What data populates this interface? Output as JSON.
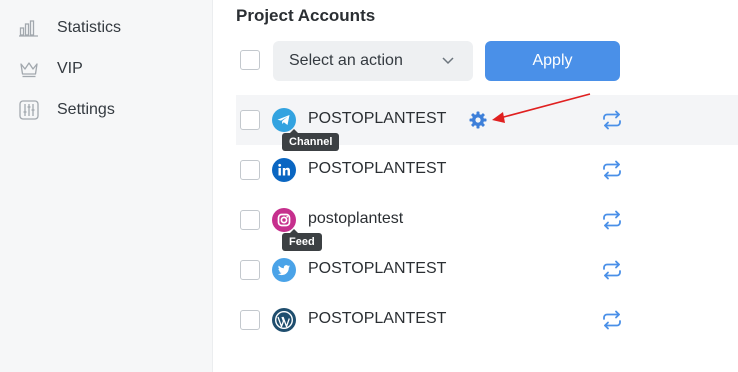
{
  "sidebar": {
    "items": [
      {
        "label": "Statistics",
        "icon": "statistics-icon"
      },
      {
        "label": "VIP",
        "icon": "crown-icon"
      },
      {
        "label": "Settings",
        "icon": "sliders-icon"
      }
    ]
  },
  "main": {
    "title": "Project Accounts",
    "action_select": {
      "value": "Select an action"
    },
    "apply_label": "Apply",
    "accounts": [
      {
        "network": "telegram",
        "icon": "telegram-icon",
        "name": "POSTOPLANTEST",
        "tooltip": "Channel",
        "highlighted": true,
        "settings_icon": "gear-icon"
      },
      {
        "network": "linkedin",
        "icon": "linkedin-icon",
        "name": "POSTOPLANTEST"
      },
      {
        "network": "instagram",
        "icon": "instagram-icon",
        "name": "postoplantest",
        "tooltip": "Feed"
      },
      {
        "network": "twitter",
        "icon": "twitter-icon",
        "name": "POSTOPLANTEST"
      },
      {
        "network": "wordpress",
        "icon": "wordpress-icon",
        "name": "POSTOPLANTEST"
      }
    ]
  },
  "colors": {
    "accent": "#4a90e8",
    "annotation_arrow": "#e02020",
    "telegram": "#33a3e0",
    "linkedin": "#0a66c2",
    "instagram": "#c62f8d",
    "twitter": "#4aa3e8",
    "wordpress": "#1f4e6e"
  }
}
